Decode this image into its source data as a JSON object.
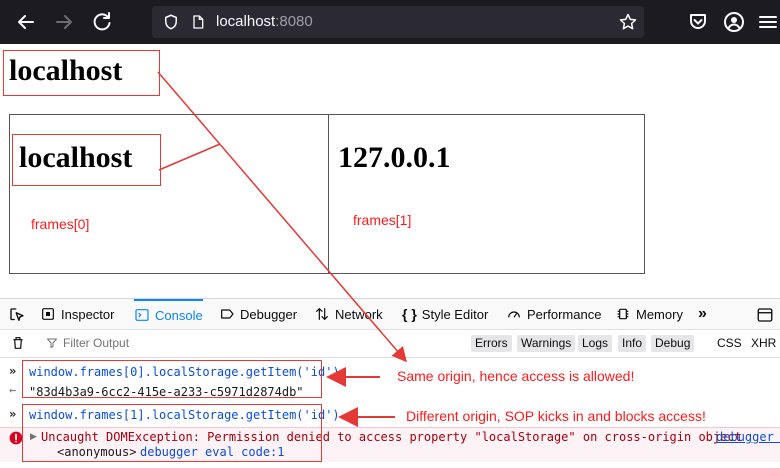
{
  "browser": {
    "url_host": "localhost",
    "url_port": ":8080"
  },
  "page": {
    "heading": "localhost",
    "frames": [
      {
        "heading": "localhost",
        "label": "frames[0]"
      },
      {
        "heading": "127.0.0.1",
        "label": "frames[1]"
      }
    ]
  },
  "devtools": {
    "tabs": [
      "Inspector",
      "Console",
      "Debugger",
      "Network",
      "Style Editor",
      "Performance",
      "Memory"
    ],
    "active_tab": "Console",
    "filter_placeholder": "Filter Output",
    "filters": [
      "Errors",
      "Warnings",
      "Logs",
      "Info",
      "Debug"
    ],
    "filter_css": "CSS",
    "filter_xhr": "XHR",
    "console": {
      "input1": "window.frames[0].localStorage.getItem('id')",
      "output1": "\"83d4b3a9-6cc2-415e-a233-c5971d2874db\"",
      "input2": "window.frames[1].localStorage.getItem('id')",
      "error": "Uncaught DOMException: Permission denied to access property \"localStorage\" on cross-origin object",
      "error_source": "debugger e",
      "stack_fn": "<anonymous>",
      "stack_loc": "debugger eval code:1"
    }
  },
  "annotations": {
    "same_origin": "Same origin, hence access is allowed!",
    "different_origin": "Different origin, SOP kicks in and blocks access!"
  },
  "colors": {
    "annotation_red": "#ff1a1a",
    "chrome_bg": "#1c1b22",
    "accent_blue": "#0a84ff"
  }
}
